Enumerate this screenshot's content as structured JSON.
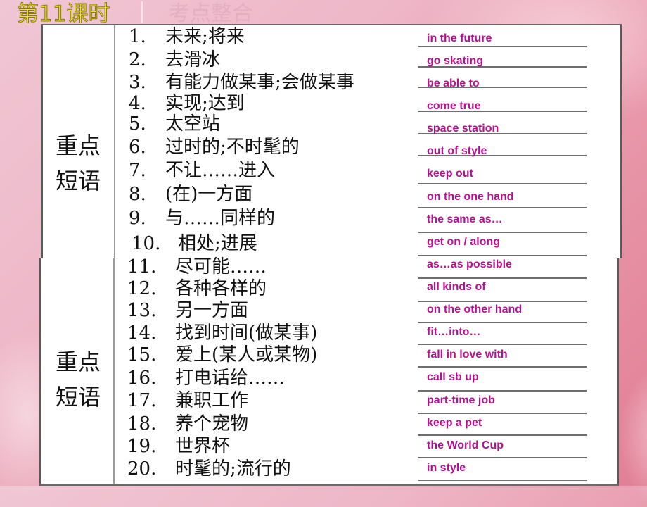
{
  "header": {
    "title": "第11课时",
    "subtitle": "考点整合"
  },
  "colors": {
    "answer": "#b5108f",
    "title": "#e8e23a",
    "background": "#eeb7c8"
  },
  "sections": [
    {
      "category": "重点短语",
      "category_line1": "重点",
      "category_line2": "短语",
      "items": [
        {
          "num": "1.",
          "zh": "未来;将来",
          "en": "in the future"
        },
        {
          "num": "2.",
          "zh": "去滑冰",
          "en": "go skating"
        },
        {
          "num": "3.",
          "zh": "有能力做某事;会做某事",
          "en": "be able to"
        },
        {
          "num": "4.",
          "zh": "实现;达到",
          "en": "come true"
        },
        {
          "num": "5.",
          "zh": "太空站",
          "en": "space station"
        },
        {
          "num": "6.",
          "zh": "过时的;不时髦的",
          "en": "out of style"
        },
        {
          "num": "7.",
          "zh": "不让……进入",
          "en": "keep  out"
        },
        {
          "num": "8.",
          "zh": "(在)一方面",
          "en": "on the one hand"
        },
        {
          "num": "9.",
          "zh": "与……同样的",
          "en": "the same as…"
        },
        {
          "num": "10.",
          "zh": "相处;进展",
          "en": "get on / along"
        }
      ]
    },
    {
      "category": "重点短语",
      "category_line1": "重点",
      "category_line2": "短语",
      "items": [
        {
          "num": "11.",
          "zh": "尽可能……",
          "en": "as…as possible"
        },
        {
          "num": "12.",
          "zh": "各种各样的",
          "en": "all kinds of"
        },
        {
          "num": "13.",
          "zh": "另一方面",
          "en": "on the other hand"
        },
        {
          "num": "14.",
          "zh": "找到时间(做某事)",
          "en": "fit…into…"
        },
        {
          "num": "15.",
          "zh": "爱上(某人或某物)",
          "en": "fall in love with"
        },
        {
          "num": "16.",
          "zh": "打电话给……",
          "en": "call sb up"
        },
        {
          "num": "17.",
          "zh": "兼职工作",
          "en": "part-time job"
        },
        {
          "num": "18.",
          "zh": "养个宠物",
          "en": "keep a pet"
        },
        {
          "num": "19.",
          "zh": "世界杯",
          "en": "the World Cup"
        },
        {
          "num": "20.",
          "zh": "时髦的;流行的",
          "en": "in style"
        }
      ]
    }
  ]
}
